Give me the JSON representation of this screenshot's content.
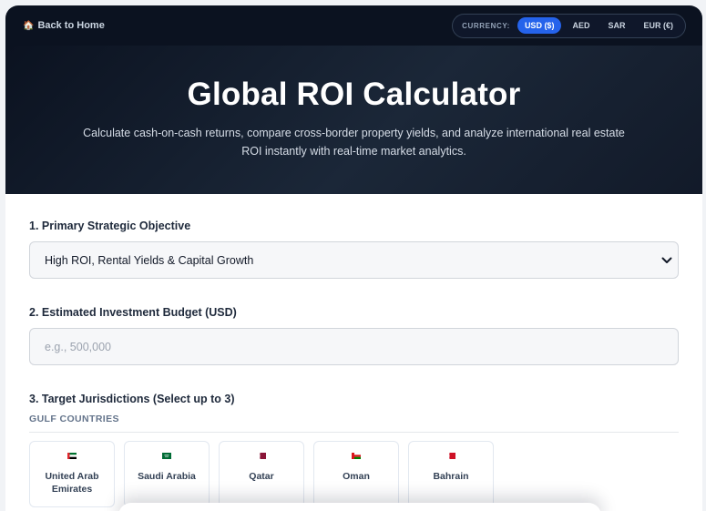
{
  "nav": {
    "back_label": "Back to Home",
    "home_icon": "house-icon"
  },
  "currency": {
    "label": "CURRENCY:",
    "options": [
      "USD ($)",
      "AED",
      "SAR",
      "EUR (€)"
    ],
    "selected": "USD ($)",
    "accent": "#2563eb"
  },
  "hero": {
    "title": "Global ROI Calculator",
    "subtitle": "Calculate cash-on-cash returns, compare cross-border property yields, and analyze international real estate ROI instantly with real-time market analytics."
  },
  "form": {
    "objective": {
      "label": "1. Primary Strategic Objective",
      "value": "High ROI, Rental Yields & Capital Growth"
    },
    "budget": {
      "label": "2. Estimated Investment Budget (USD)",
      "placeholder": "e.g., 500,000"
    },
    "jurisdictions": {
      "label": "3. Target Jurisdictions (Select up to 3)",
      "group": "GULF COUNTRIES",
      "countries": [
        {
          "name": "United Arab Emirates",
          "flag": "uae-flag-icon"
        },
        {
          "name": "Saudi Arabia",
          "flag": "saudi-flag-icon"
        },
        {
          "name": "Qatar",
          "flag": "qatar-flag-icon"
        },
        {
          "name": "Oman",
          "flag": "oman-flag-icon"
        },
        {
          "name": "Bahrain",
          "flag": "bahrain-flag-icon"
        }
      ]
    }
  }
}
